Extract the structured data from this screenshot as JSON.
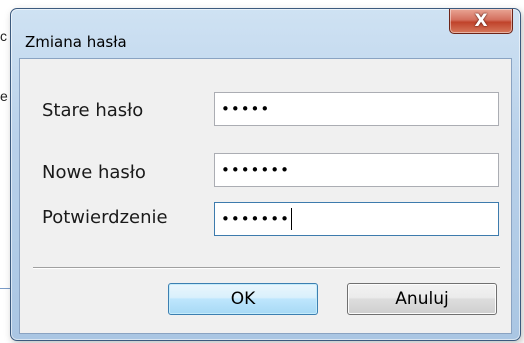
{
  "background": {
    "fragment_top": "c",
    "fragment_mid": "e"
  },
  "dialog": {
    "title": "Zmiana hasła",
    "close_glyph": "X",
    "fields": {
      "old": {
        "label": "Stare hasło",
        "value": "•••••"
      },
      "new": {
        "label": "Nowe hasło",
        "value": "•••••••"
      },
      "confirm": {
        "label": "Potwierdzenie",
        "value": "•••••••"
      }
    },
    "ok_label": "OK",
    "cancel_label": "Anuluj"
  },
  "colors": {
    "frame": "#b9d1ea",
    "client": "#f0f0f0",
    "close_button": "#c0432b",
    "ok_border": "#3c7fb1"
  }
}
